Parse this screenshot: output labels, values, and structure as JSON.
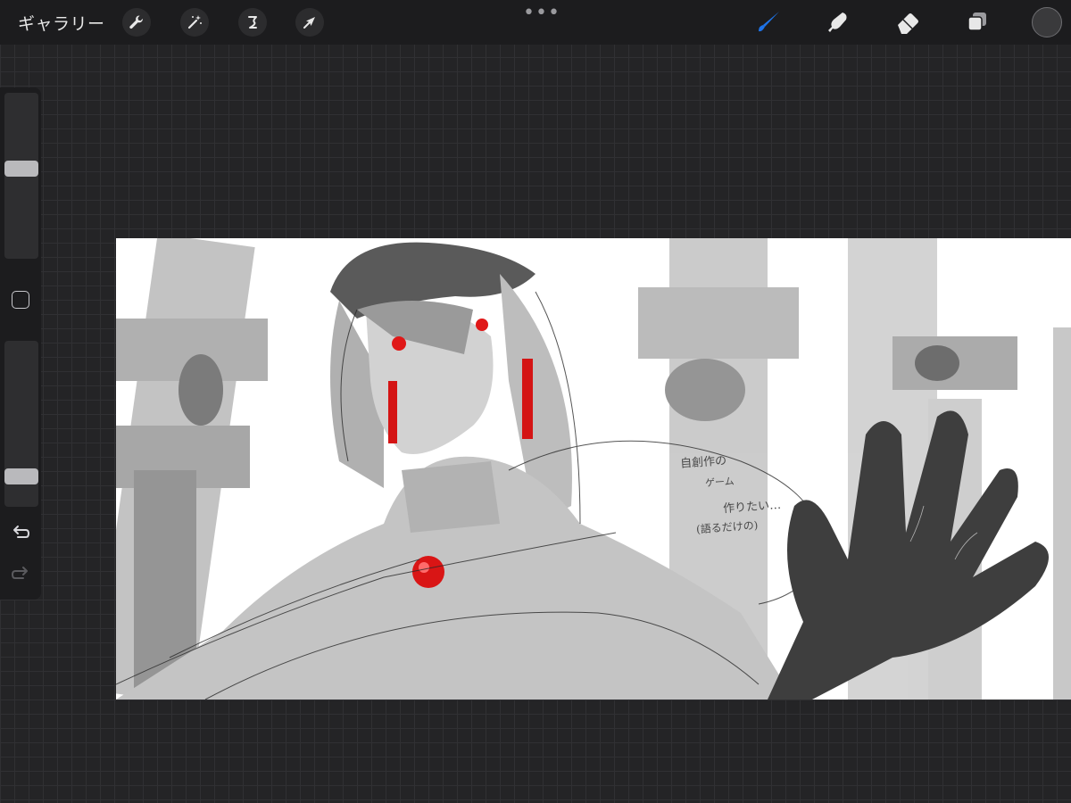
{
  "toolbar": {
    "gallery_label": "ギャラリー",
    "more_dots": "•••",
    "left_tools": [
      "wrench-icon",
      "magic-wand-icon",
      "selection-icon",
      "transform-arrow-icon"
    ],
    "right_tools": [
      "brush-icon",
      "smudge-icon",
      "eraser-icon",
      "layers-icon"
    ],
    "active_tool_color": "#1e73e8",
    "current_color": "#3a3a3c"
  },
  "sidebar": {
    "brush_size": 0.55,
    "brush_opacity": 0.15,
    "icons": [
      "modify-square-icon",
      "undo-icon",
      "redo-icon"
    ]
  },
  "canvas": {
    "accent_color": "#e01818",
    "handwritten_note": [
      "自創作の",
      "ゲーム",
      "作りたい…",
      "(語るだけの)"
    ]
  }
}
